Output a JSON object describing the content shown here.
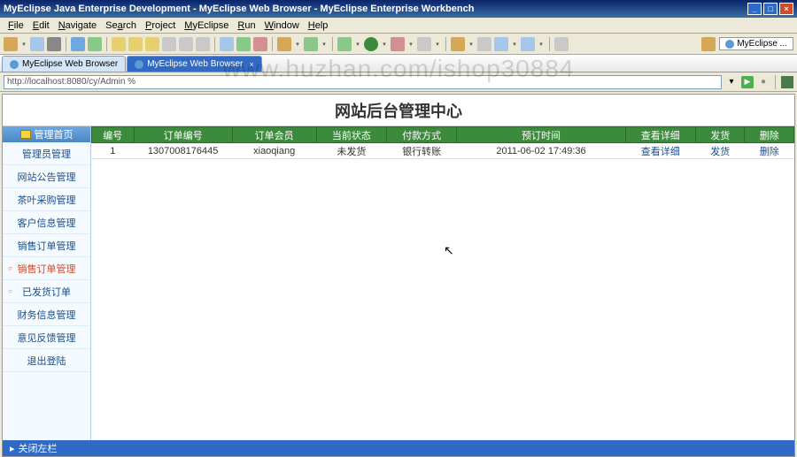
{
  "window": {
    "title": "MyEclipse Java Enterprise Development - MyEclipse Web Browser - MyEclipse Enterprise Workbench"
  },
  "menu": {
    "items": [
      "File",
      "Edit",
      "Navigate",
      "Search",
      "Project",
      "MyEclipse",
      "Run",
      "Window",
      "Help"
    ]
  },
  "toolbar_right": {
    "label": "MyEclipse ..."
  },
  "tabs": [
    {
      "label": "MyEclipse Web Browser",
      "active": false
    },
    {
      "label": "MyEclipse Web Browser",
      "active": true
    }
  ],
  "address": {
    "url": "http://localhost:8080/cy/Admin %"
  },
  "watermark": "www.huzhan.com/ishop30884",
  "page": {
    "title": "网站后台管理中心"
  },
  "sidebar": {
    "header": "管理首页",
    "items": [
      {
        "label": "管理员管理",
        "active": false,
        "bullet": false
      },
      {
        "label": "网站公告管理",
        "active": false,
        "bullet": false
      },
      {
        "label": "茶叶采购管理",
        "active": false,
        "bullet": false
      },
      {
        "label": "客户信息管理",
        "active": false,
        "bullet": false
      },
      {
        "label": "销售订单管理",
        "active": false,
        "bullet": false
      },
      {
        "label": "销售订单管理",
        "active": true,
        "bullet": true
      },
      {
        "label": "已发货订单",
        "active": false,
        "bullet": true
      },
      {
        "label": "财务信息管理",
        "active": false,
        "bullet": false
      },
      {
        "label": "意见反馈管理",
        "active": false,
        "bullet": false
      },
      {
        "label": "退出登陆",
        "active": false,
        "bullet": false
      }
    ]
  },
  "table": {
    "headers": [
      "编号",
      "订单编号",
      "订单会员",
      "当前状态",
      "付款方式",
      "预订时间",
      "查看详细",
      "发货",
      "删除"
    ],
    "rows": [
      {
        "id": "1",
        "order_no": "1307008176445",
        "member": "xiaoqiang",
        "status": "未发货",
        "payment": "银行转账",
        "time": "2011-06-02 17:49:36",
        "view": "查看详细",
        "ship": "发货",
        "delete": "删除"
      }
    ]
  },
  "bottom": {
    "label": "关闭左栏"
  }
}
